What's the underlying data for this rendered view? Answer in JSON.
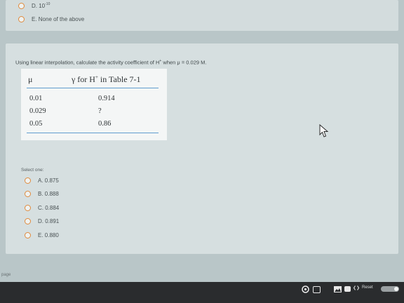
{
  "prev_question": {
    "options": [
      {
        "label": "D. 10",
        "superscript": "-10"
      },
      {
        "label": "E. None of the above"
      }
    ]
  },
  "question": {
    "text_before": "Using linear interpolation, calculate the activity coefficient of H",
    "superscript": "+",
    "text_after": " when μ = 0.029 M."
  },
  "table": {
    "header_mu": "μ",
    "header_gamma_pre": "γ for H",
    "header_gamma_sup": "+",
    "header_gamma_post": " in Table 7-1",
    "rows": [
      {
        "mu": "0.01",
        "gamma": "0.914"
      },
      {
        "mu": "0.029",
        "gamma": "?"
      },
      {
        "mu": "0.05",
        "gamma": "0.86"
      }
    ]
  },
  "select_label": "Select one:",
  "options": [
    {
      "label": "A. 0.875"
    },
    {
      "label": "B. 0.888"
    },
    {
      "label": "C. 0.884"
    },
    {
      "label": "D. 0.891"
    },
    {
      "label": "E. 0.880"
    }
  ],
  "footer": {
    "page_label": "page"
  },
  "taskbar": {
    "reset_label": "Reset"
  },
  "colors": {
    "radio_ring": "#e08a3c",
    "table_rule": "#5f9ccf"
  }
}
